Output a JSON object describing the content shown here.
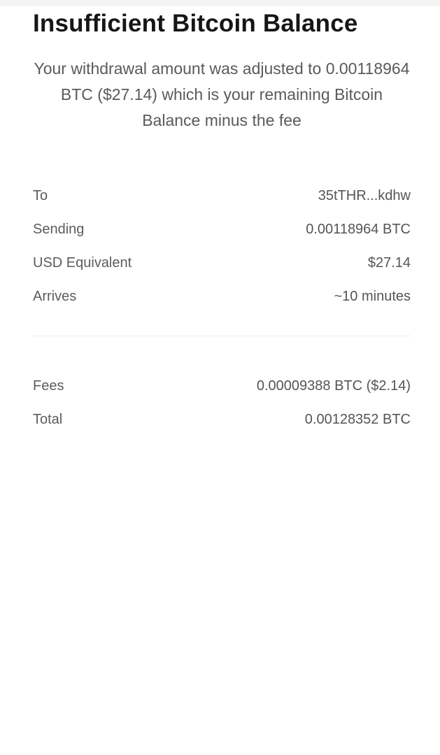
{
  "dialog": {
    "title": "Insufficient Bitcoin Balance",
    "message": "Your withdrawal amount was adjusted to 0.00118964 BTC ($27.14) which is your remaining Bitcoin Balance minus the fee"
  },
  "details": [
    {
      "label": "To",
      "value": "35tTHR...kdhw"
    },
    {
      "label": "Sending",
      "value": "0.00118964 BTC"
    },
    {
      "label": "USD Equivalent",
      "value": "$27.14"
    },
    {
      "label": "Arrives",
      "value": "~10 minutes"
    }
  ],
  "summary": [
    {
      "label": "Fees",
      "value": "0.00009388 BTC ($2.14)"
    },
    {
      "label": "Total",
      "value": "0.00128352 BTC"
    }
  ]
}
